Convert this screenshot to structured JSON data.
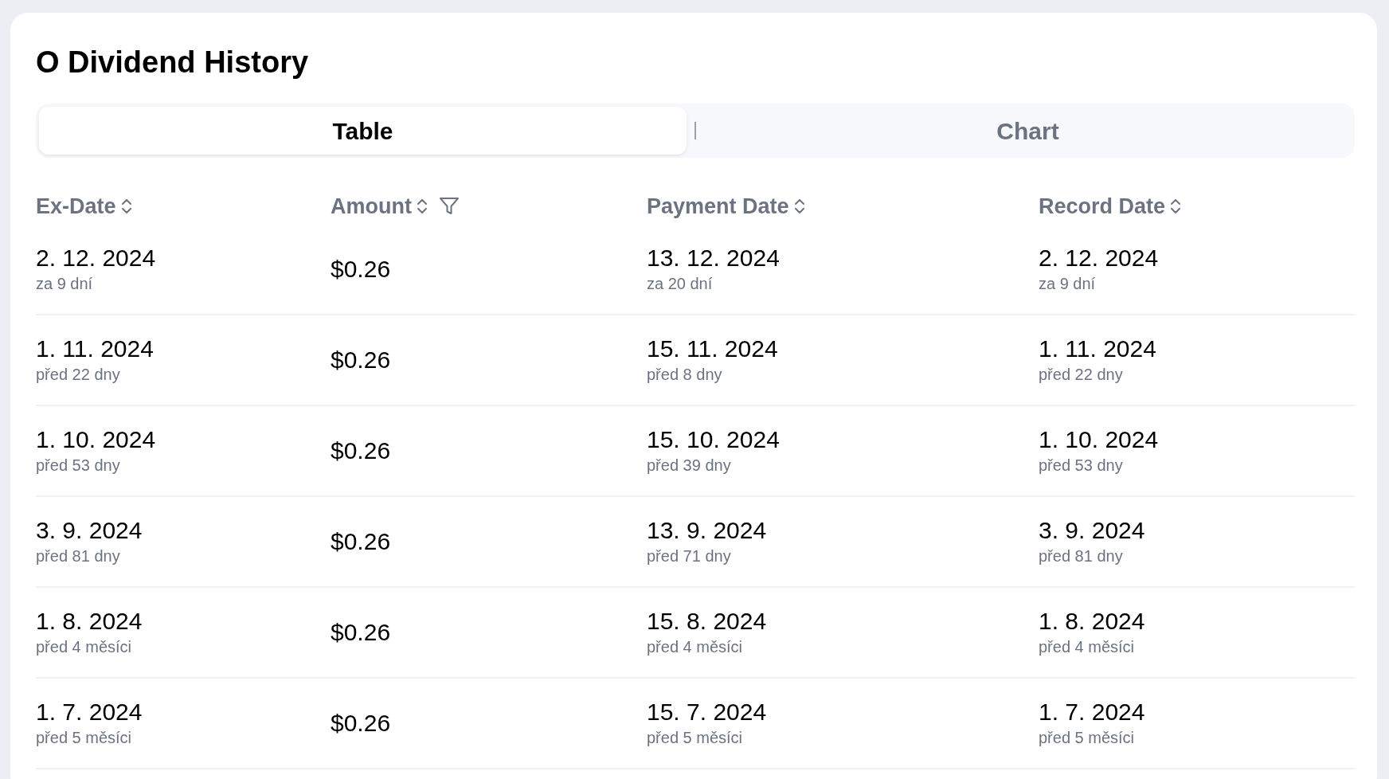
{
  "title": "O Dividend History",
  "tabs": [
    {
      "label": "Table",
      "selected": true
    },
    {
      "label": "Chart",
      "selected": false
    }
  ],
  "table": {
    "columns": [
      {
        "label": "Ex-Date",
        "sortable": true,
        "filterable": false
      },
      {
        "label": "Amount",
        "sortable": true,
        "filterable": true
      },
      {
        "label": "Payment Date",
        "sortable": true,
        "filterable": false
      },
      {
        "label": "Record Date",
        "sortable": true,
        "filterable": false
      }
    ],
    "rows": [
      {
        "ex_date": {
          "date": "2. 12. 2024",
          "relative": "za 9 dní"
        },
        "amount": "$0.26",
        "payment_date": {
          "date": "13. 12. 2024",
          "relative": "za 20 dní"
        },
        "record_date": {
          "date": "2. 12. 2024",
          "relative": "za 9 dní"
        }
      },
      {
        "ex_date": {
          "date": "1. 11. 2024",
          "relative": "před 22 dny"
        },
        "amount": "$0.26",
        "payment_date": {
          "date": "15. 11. 2024",
          "relative": "před 8 dny"
        },
        "record_date": {
          "date": "1. 11. 2024",
          "relative": "před 22 dny"
        }
      },
      {
        "ex_date": {
          "date": "1. 10. 2024",
          "relative": "před 53 dny"
        },
        "amount": "$0.26",
        "payment_date": {
          "date": "15. 10. 2024",
          "relative": "před 39 dny"
        },
        "record_date": {
          "date": "1. 10. 2024",
          "relative": "před 53 dny"
        }
      },
      {
        "ex_date": {
          "date": "3. 9. 2024",
          "relative": "před 81 dny"
        },
        "amount": "$0.26",
        "payment_date": {
          "date": "13. 9. 2024",
          "relative": "před 71 dny"
        },
        "record_date": {
          "date": "3. 9. 2024",
          "relative": "před 81 dny"
        }
      },
      {
        "ex_date": {
          "date": "1. 8. 2024",
          "relative": "před 4 měsíci"
        },
        "amount": "$0.26",
        "payment_date": {
          "date": "15. 8. 2024",
          "relative": "před 4 měsíci"
        },
        "record_date": {
          "date": "1. 8. 2024",
          "relative": "před 4 měsíci"
        }
      },
      {
        "ex_date": {
          "date": "1. 7. 2024",
          "relative": "před 5 měsíci"
        },
        "amount": "$0.26",
        "payment_date": {
          "date": "15. 7. 2024",
          "relative": "před 5 měsíci"
        },
        "record_date": {
          "date": "1. 7. 2024",
          "relative": "před 5 měsíci"
        }
      }
    ]
  }
}
